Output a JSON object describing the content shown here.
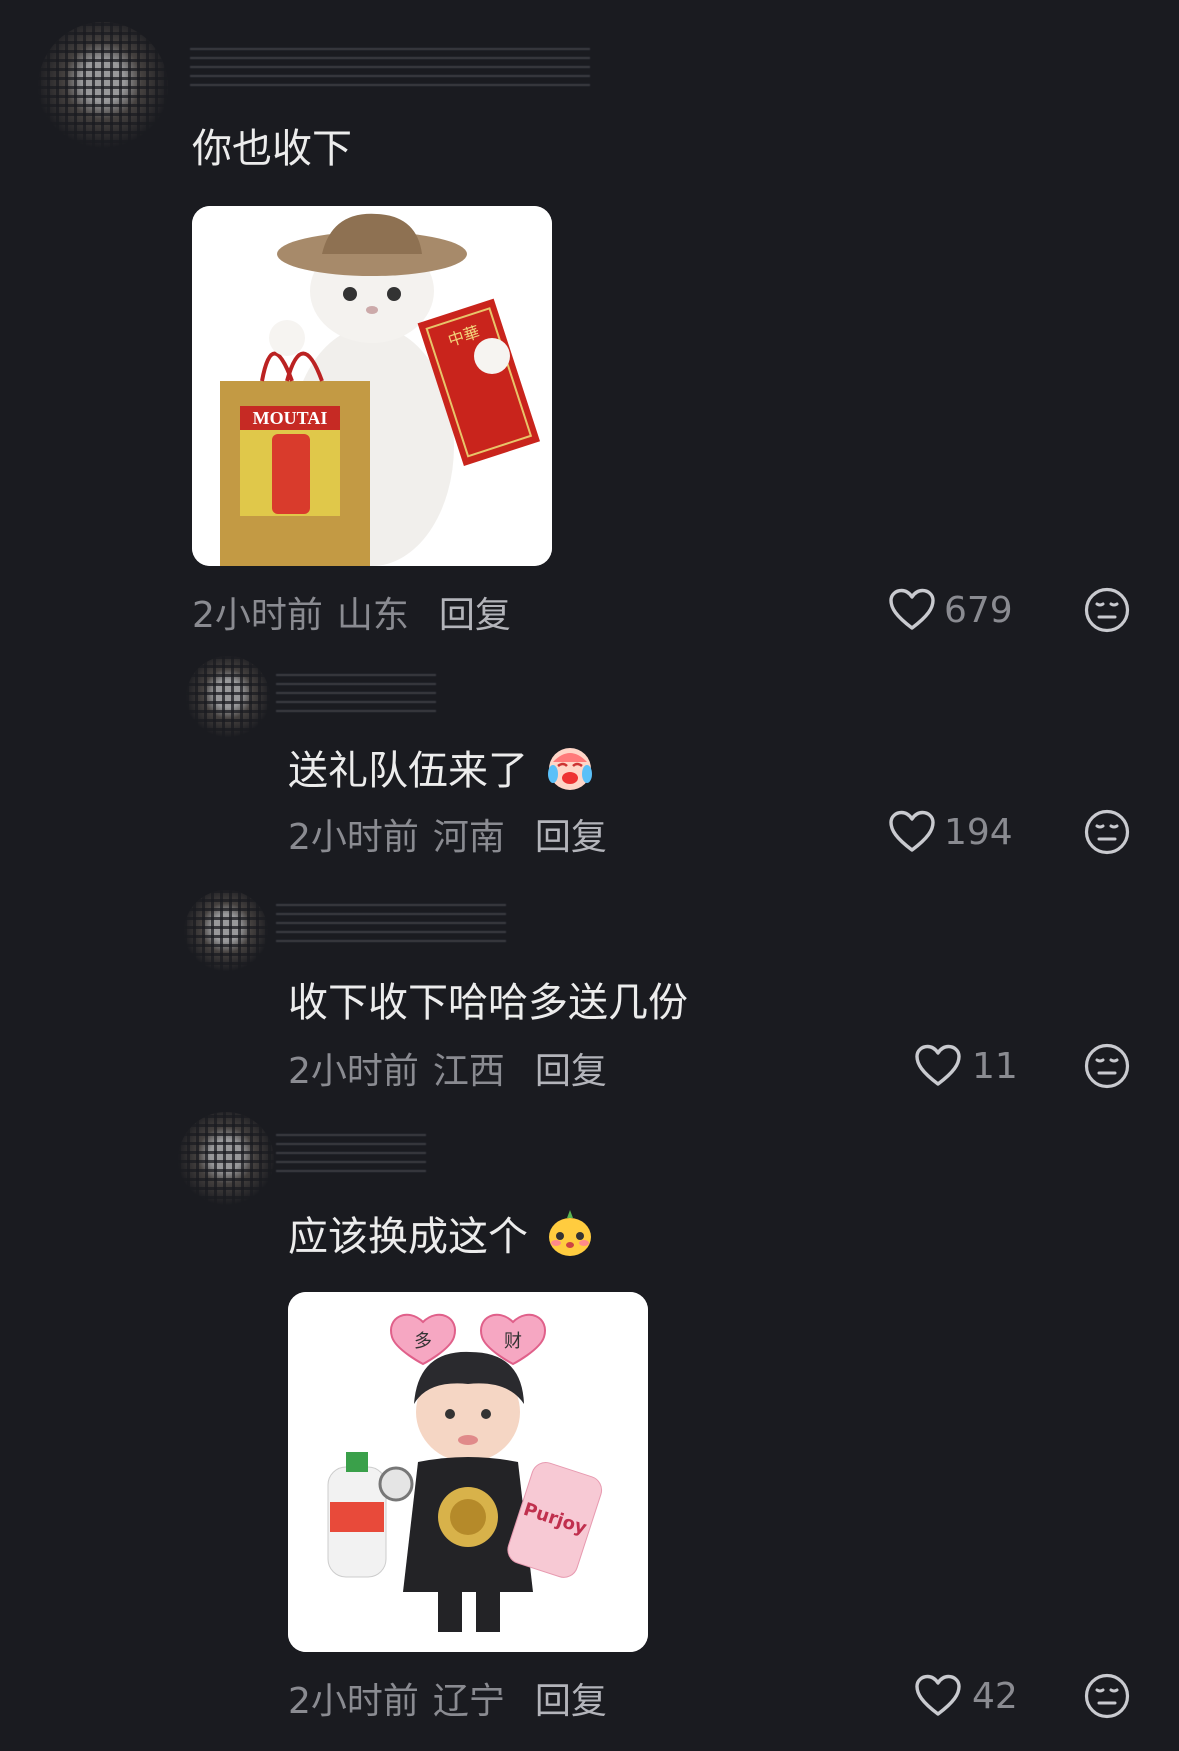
{
  "comments": [
    {
      "text": "你也收下",
      "time": "2小时前",
      "location": "山东",
      "reply_label": "回复",
      "likes": "679",
      "image_desc": "cat-with-gifts-sticker"
    },
    {
      "text": "送礼队伍来了",
      "time": "2小时前",
      "location": "河南",
      "reply_label": "回复",
      "likes": "194",
      "emoji": "crying-laughing-emoji"
    },
    {
      "text": "收下收下哈哈多送几份",
      "time": "2小时前",
      "location": "江西",
      "reply_label": "回复",
      "likes": "11"
    },
    {
      "text": "应该换成这个",
      "time": "2小时前",
      "location": "辽宁",
      "reply_label": "回复",
      "likes": "42",
      "emoji": "shy-face-emoji",
      "image_desc": "boy-with-gifts-sticker"
    }
  ],
  "sticker_text": {
    "moutai": "MOUTAI",
    "zhonghua": "中華",
    "purjoy": "Purjoy",
    "heart_left": "多",
    "heart_right": "财"
  },
  "colors": {
    "background": "#1a1b20",
    "text": "#ececec",
    "meta": "#8a8b91"
  }
}
